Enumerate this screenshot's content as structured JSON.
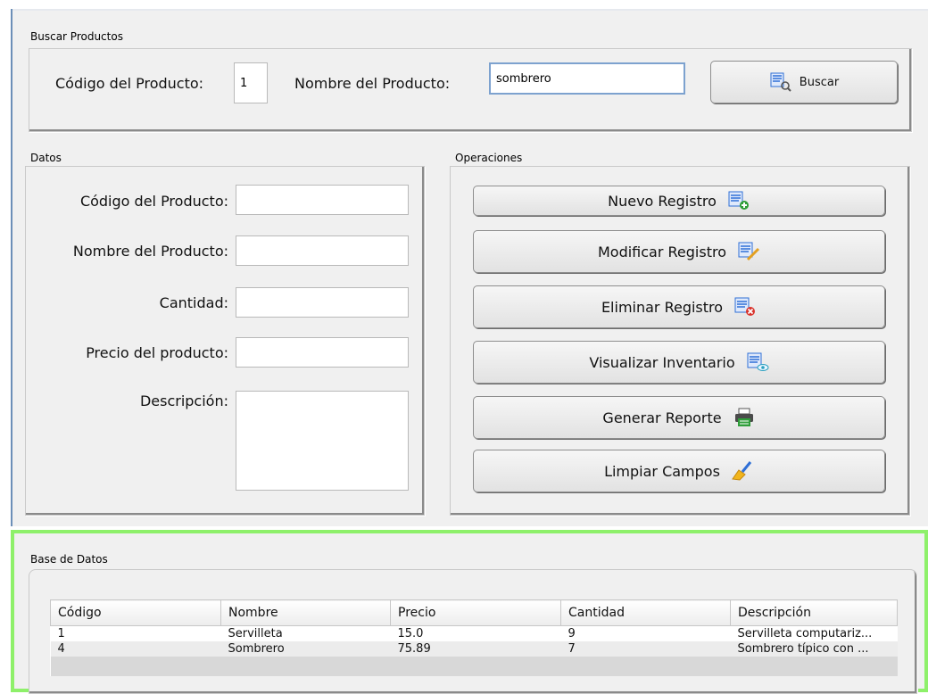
{
  "search": {
    "group_title": "Buscar Productos",
    "code_label": "Código del Producto:",
    "code_value": "1",
    "name_label": "Nombre del Producto:",
    "name_value": "sombrero",
    "button_label": "Buscar",
    "button_icon": "search-list-icon"
  },
  "datos": {
    "group_title": "Datos",
    "fields": [
      {
        "label": "Código del Producto:",
        "value": ""
      },
      {
        "label": "Nombre del Producto:",
        "value": ""
      },
      {
        "label": "Cantidad:",
        "value": ""
      },
      {
        "label": "Precio del producto:",
        "value": ""
      },
      {
        "label": "Descripción:",
        "value": ""
      }
    ]
  },
  "operaciones": {
    "group_title": "Operaciones",
    "buttons": [
      {
        "label": "Nuevo Registro",
        "icon": "add-record-icon"
      },
      {
        "label": "Modificar Registro",
        "icon": "edit-record-icon"
      },
      {
        "label": "Eliminar Registro",
        "icon": "delete-record-icon"
      },
      {
        "label": "Visualizar Inventario",
        "icon": "view-record-icon"
      },
      {
        "label": "Generar Reporte",
        "icon": "printer-icon"
      },
      {
        "label": "Limpiar Campos",
        "icon": "broom-icon"
      }
    ]
  },
  "database": {
    "group_title": "Base de Datos",
    "columns": [
      "Código",
      "Nombre",
      "Precio",
      "Cantidad",
      "Descripción"
    ],
    "rows": [
      [
        "1",
        "Servilleta",
        "15.0",
        "9",
        "Servilleta computariz..."
      ],
      [
        "4",
        "Sombrero",
        "75.89",
        "7",
        "Sombrero típico con ..."
      ]
    ]
  },
  "colors": {
    "accent_green": "#8ef06a",
    "icon_blue": "#2f6fd6",
    "left_border": "#6c8fb8"
  }
}
